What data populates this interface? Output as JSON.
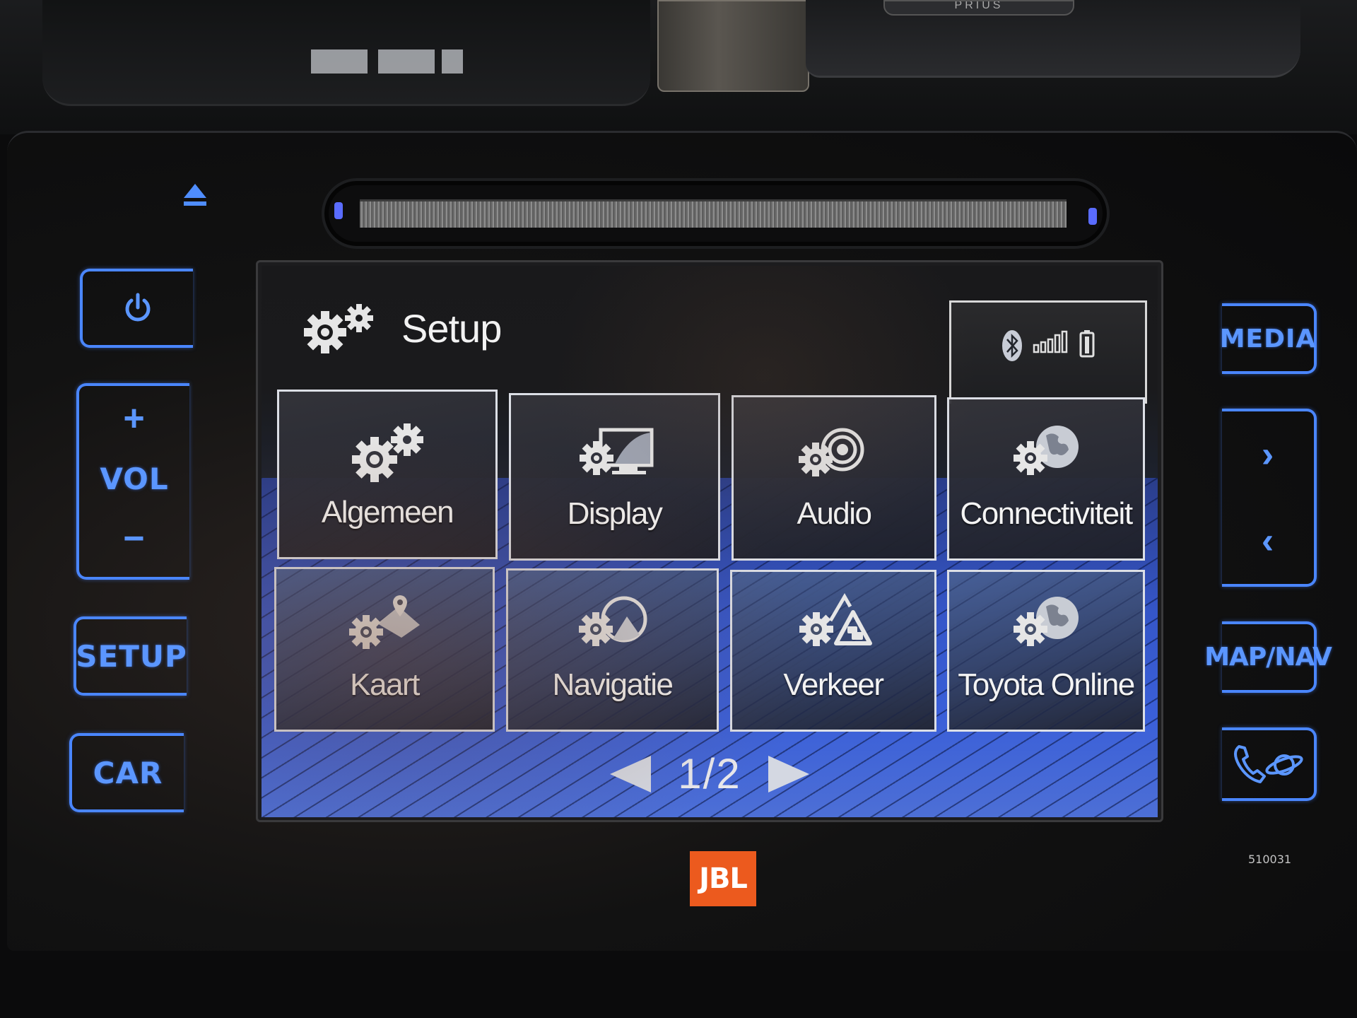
{
  "vehicle_badge": "PRIUS",
  "screen": {
    "title": "Setup",
    "title_icon": "gears-icon",
    "status": {
      "bluetooth_icon": "bluetooth-icon",
      "signal_icon": "signal-strength-icon",
      "signal_bars": 5,
      "battery_icon": "battery-icon"
    },
    "tiles": [
      {
        "label": "Algemeen",
        "icon": "gears-icon"
      },
      {
        "label": "Display",
        "icon": "display-settings-icon"
      },
      {
        "label": "Audio",
        "icon": "audio-settings-icon"
      },
      {
        "label": "Connectiviteit",
        "icon": "connectivity-globe-icon"
      },
      {
        "label": "Kaart",
        "icon": "map-settings-icon"
      },
      {
        "label": "Navigatie",
        "icon": "navigation-settings-icon"
      },
      {
        "label": "Verkeer",
        "icon": "traffic-settings-icon"
      },
      {
        "label": "Toyota Online",
        "icon": "toyota-online-globe-icon"
      }
    ],
    "pager": {
      "text": "1/2",
      "current_page": 1,
      "total_pages": 2
    }
  },
  "hardware_buttons": {
    "left": {
      "eject": "eject-icon",
      "power": "power-icon",
      "vol_plus": "+",
      "vol_label": "VOL",
      "vol_minus": "−",
      "setup": "SETUP",
      "car": "CAR"
    },
    "right": {
      "media": "MEDIA",
      "seek_next": "›",
      "seek_prev": "‹",
      "map_nav": "MAP/NAV",
      "phone": "phone-apps-icon"
    }
  },
  "brand_logo": "JBL",
  "serial_number": "510031",
  "colors": {
    "button_glow": "#4a86ff",
    "screen_blue": "#3a5fd8",
    "jbl_orange": "#ec5a1e",
    "tile_border": "#dcdfe6"
  }
}
